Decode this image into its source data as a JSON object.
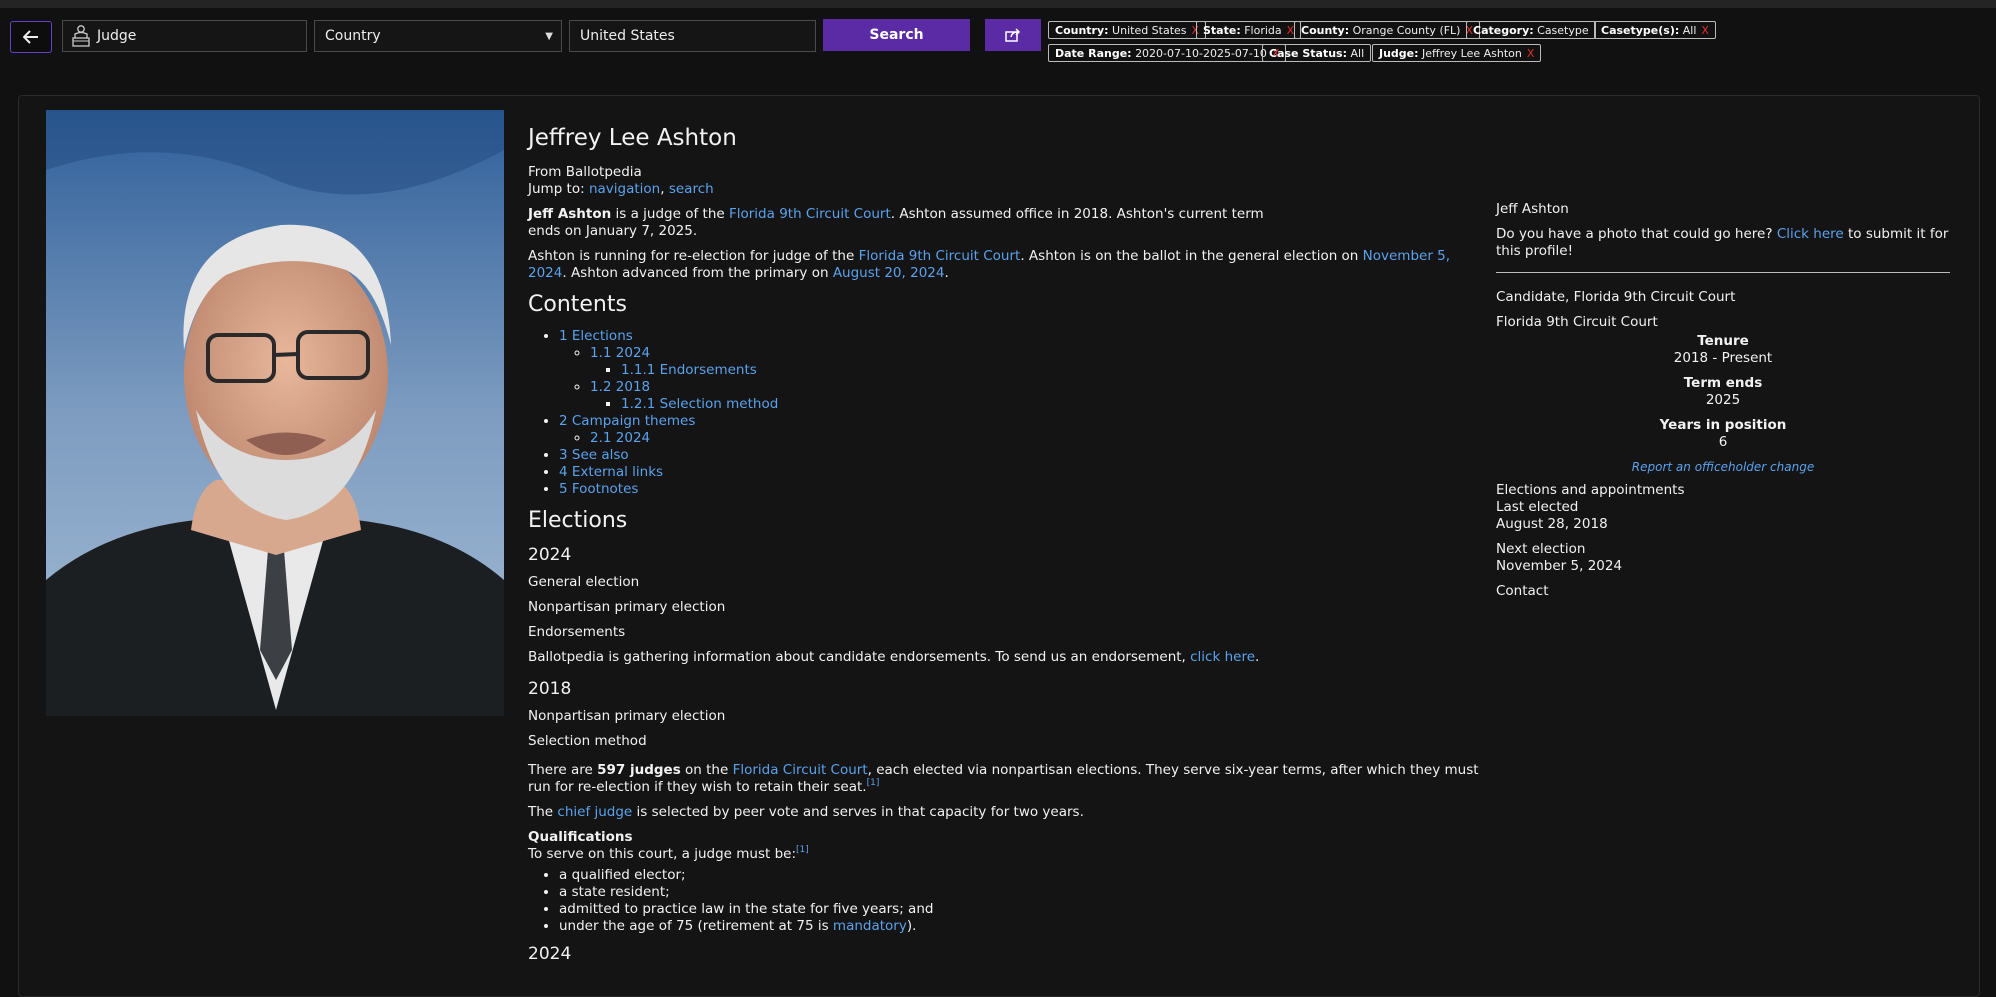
{
  "toolbar": {
    "category_value": "Judge",
    "country_select": "Country",
    "search_value": "United States",
    "search_label": "Search"
  },
  "filters": [
    {
      "key": "Country:",
      "value": "United States"
    },
    {
      "key": "State:",
      "value": "Florida"
    },
    {
      "key": "County:",
      "value": "Orange County (FL)"
    },
    {
      "key": "Category:",
      "value": "Casetype"
    },
    {
      "key": "Casetype(s):",
      "value": "All"
    },
    {
      "key": "Date Range:",
      "value": "2020-07-10-2025-07-10"
    },
    {
      "key": "Case Status:",
      "value": "All"
    },
    {
      "key": "Judge:",
      "value": "Jeffrey Lee Ashton"
    }
  ],
  "filter_remove": "X",
  "article": {
    "title": "Jeffrey Lee Ashton",
    "from": "From Ballotpedia",
    "jump_to": "Jump to:",
    "jump_nav": "navigation",
    "jump_search": "search",
    "intro1": {
      "bold": "Jeff Ashton",
      "t1": " is a judge of the ",
      "link": "Florida 9th Circuit Court",
      "t2": ". Ashton assumed office in 2018. Ashton's current term ends on January 7, 2025."
    },
    "intro2": {
      "t1": "Ashton is running for re-election for judge of the ",
      "link1": "Florida 9th Circuit Court",
      "t2": ". Ashton is on the ballot in the general election on ",
      "link2": "November 5, 2024",
      "t3": ". Ashton advanced from the primary on ",
      "link3": "August 20, 2024",
      "t4": "."
    },
    "contents_heading": "Contents",
    "toc": {
      "elections": "1 Elections",
      "y2024": "1.1 2024",
      "endorsements": "1.1.1 Endorsements",
      "y2018": "1.2 2018",
      "selection": "1.2.1 Selection method",
      "campaign": "2 Campaign themes",
      "campaign2024": "2.1 2024",
      "see_also": "3 See also",
      "external": "4 External links",
      "footnotes": "5 Footnotes"
    },
    "elections_heading": "Elections",
    "y2024_heading": "2024",
    "general_election": "General election",
    "nonpartisan_primary": "Nonpartisan primary election",
    "endorsements_heading": "Endorsements",
    "endorse_text": "Ballotpedia is gathering information about candidate endorsements. To send us an endorsement, ",
    "endorse_link": "click here",
    "endorse_end": ".",
    "y2018_heading": "2018",
    "nonpartisan_primary_2018": "Nonpartisan primary election",
    "selection_heading": "Selection method",
    "sel_text": {
      "t1": "There are ",
      "bold": "597 judges",
      "t2": " on the ",
      "link": "Florida Circuit Court",
      "t3": ", each elected via nonpartisan elections. They serve six-year terms, after which they must run for re-election if they wish to retain their seat.",
      "ref": "[1]"
    },
    "chief_text": {
      "t1": "The ",
      "link": "chief judge",
      "t2": " is selected by peer vote and serves in that capacity for two years."
    },
    "qual_heading": "Qualifications",
    "qual_intro": "To serve on this court, a judge must be:",
    "qual_ref": "[1]",
    "quals": {
      "q1": "a qualified elector;",
      "q2": "a state resident;",
      "q3": "admitted to practice law in the state for five years; and",
      "q4a": "under the age of 75 (retirement at 75 is ",
      "q4link": "mandatory",
      "q4b": ")."
    },
    "y2024_heading_b": "2024"
  },
  "sidebar": {
    "name": "Jeff Ashton",
    "photo_text": "Do you have a photo that could go here? ",
    "photo_link": "Click here",
    "photo_text2": " to submit it for this profile!",
    "role": "Candidate, Florida 9th Circuit Court",
    "court": "Florida 9th Circuit Court",
    "tenure_label": "Tenure",
    "tenure_value": "2018 - Present",
    "term_label": "Term ends",
    "term_value": "2025",
    "years_label": "Years in position",
    "years_value": "6",
    "report_link": "Report an officeholder change",
    "elections_heading": "Elections and appointments",
    "last_label": "Last elected",
    "last_value": "August 28, 2018",
    "next_label": "Next election",
    "next_value": "November 5, 2024",
    "contact": "Contact"
  },
  "colors": {
    "accent": "#5b2ba5",
    "link": "#5aa2ec",
    "remove_x": "#e0302a",
    "background": "#111111"
  }
}
